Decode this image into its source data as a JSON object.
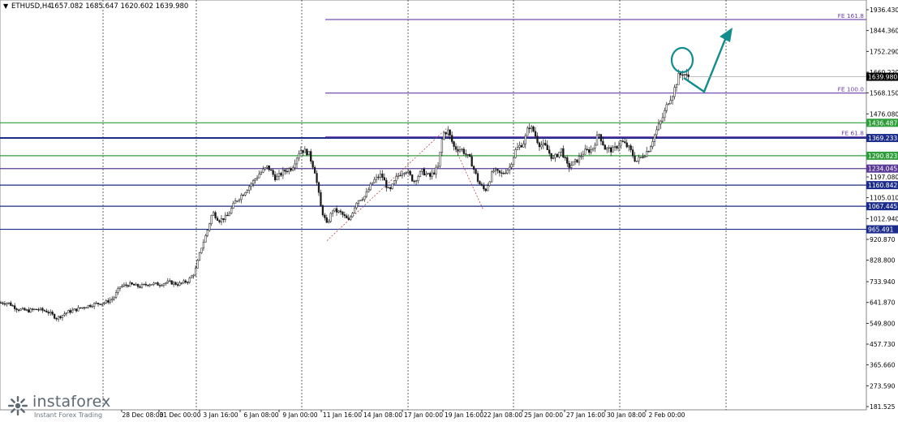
{
  "header": {
    "symbol": "ETHUSD,H4",
    "ohlc": "1657.082 1685.647 1620.602 1639.980"
  },
  "colors": {
    "fib_line": "#6a3aa8",
    "support_green": "#2f9e3a",
    "level_blue": "#1c2c8a",
    "level_purple": "#5a3a96",
    "arrow": "#138c8e",
    "candle": "#1a1a1a",
    "grid": "#000000",
    "current_price_bg": "#000000"
  },
  "chart_data": {
    "type": "candlestick",
    "symbol": "ETHUSD",
    "timeframe": "H4",
    "ylim": [
      181.525,
      1981
    ],
    "y_ticks": [
      1936.43,
      1844.36,
      1752.29,
      1660.22,
      1568.15,
      1476.08,
      1197.08,
      1105.01,
      1012.94,
      920.87,
      828.8,
      733.94,
      641.87,
      549.8,
      457.73,
      365.66,
      273.59,
      181.525
    ],
    "x_tick_labels": [
      "28 Dec 08:00",
      "31 Dec 00:00",
      "3 Jan 16:00",
      "6 Jan 08:00",
      "9 Jan 00:00",
      "11 Jan 16:00",
      "14 Jan 08:00",
      "17 Jan 00:00",
      "19 Jan 16:00",
      "22 Jan 08:00",
      "25 Jan 00:00",
      "27 Jan 16:00",
      "30 Jan 08:00",
      "2 Feb 00:00"
    ],
    "price_path": [
      [
        0,
        641
      ],
      [
        10,
        640
      ],
      [
        22,
        612
      ],
      [
        34,
        605
      ],
      [
        46,
        612
      ],
      [
        58,
        603
      ],
      [
        70,
        572
      ],
      [
        82,
        598
      ],
      [
        94,
        611
      ],
      [
        106,
        625
      ],
      [
        118,
        636
      ],
      [
        130,
        642
      ],
      [
        140,
        662
      ],
      [
        148,
        712
      ],
      [
        160,
        722
      ],
      [
        172,
        712
      ],
      [
        184,
        725
      ],
      [
        196,
        722
      ],
      [
        208,
        732
      ],
      [
        220,
        722
      ],
      [
        232,
        738
      ],
      [
        240,
        775
      ],
      [
        248,
        882
      ],
      [
        255,
        952
      ],
      [
        262,
        1042
      ],
      [
        270,
        1005
      ],
      [
        280,
        1022
      ],
      [
        290,
        1087
      ],
      [
        300,
        1126
      ],
      [
        310,
        1168
      ],
      [
        320,
        1212
      ],
      [
        330,
        1243
      ],
      [
        340,
        1190
      ],
      [
        350,
        1222
      ],
      [
        360,
        1238
      ],
      [
        370,
        1318
      ],
      [
        380,
        1305
      ],
      [
        388,
        1225
      ],
      [
        396,
        1055
      ],
      [
        403,
        985
      ],
      [
        410,
        1052
      ],
      [
        420,
        1038
      ],
      [
        430,
        1002
      ],
      [
        440,
        1092
      ],
      [
        450,
        1112
      ],
      [
        460,
        1178
      ],
      [
        470,
        1208
      ],
      [
        480,
        1130
      ],
      [
        490,
        1202
      ],
      [
        500,
        1230
      ],
      [
        510,
        1178
      ],
      [
        520,
        1222
      ],
      [
        530,
        1198
      ],
      [
        540,
        1240
      ],
      [
        546,
        1388
      ],
      [
        552,
        1402
      ],
      [
        560,
        1326
      ],
      [
        570,
        1316
      ],
      [
        580,
        1272
      ],
      [
        590,
        1172
      ],
      [
        598,
        1135
      ],
      [
        608,
        1225
      ],
      [
        618,
        1208
      ],
      [
        628,
        1238
      ],
      [
        636,
        1318
      ],
      [
        646,
        1352
      ],
      [
        652,
        1424
      ],
      [
        658,
        1398
      ],
      [
        664,
        1344
      ],
      [
        672,
        1332
      ],
      [
        682,
        1275
      ],
      [
        692,
        1318
      ],
      [
        700,
        1240
      ],
      [
        710,
        1265
      ],
      [
        720,
        1308
      ],
      [
        730,
        1318
      ],
      [
        738,
        1390
      ],
      [
        746,
        1322
      ],
      [
        756,
        1315
      ],
      [
        766,
        1355
      ],
      [
        776,
        1322
      ],
      [
        784,
        1265
      ],
      [
        792,
        1290
      ],
      [
        800,
        1320
      ],
      [
        808,
        1392
      ],
      [
        816,
        1452
      ],
      [
        824,
        1532
      ],
      [
        830,
        1570
      ],
      [
        836,
        1640
      ],
      [
        842,
        1660
      ],
      [
        846,
        1640
      ],
      [
        849,
        1639.98
      ]
    ],
    "current_price": 1639.98,
    "levels": [
      {
        "label": "1436.487",
        "price": 1436.487,
        "color": "support_green",
        "x_start": 0
      },
      {
        "label": "1369.233",
        "price": 1369.233,
        "color": "level_blue",
        "x_start": 0,
        "bold": true
      },
      {
        "label": "1290.823",
        "price": 1290.823,
        "color": "support_green",
        "x_start": 0
      },
      {
        "label": "1234.045",
        "price": 1234.045,
        "color": "level_purple",
        "x_start": 0
      },
      {
        "label": "1160.842",
        "price": 1160.842,
        "color": "level_blue",
        "x_start": 0
      },
      {
        "label": "1067.445",
        "price": 1067.445,
        "color": "level_blue",
        "x_start": 0
      },
      {
        "label": "965.491",
        "price": 965.491,
        "color": "level_blue",
        "x_start": 0
      }
    ],
    "fib_levels": [
      {
        "label": "FE 161.8",
        "price": 1893
      },
      {
        "label": "FE 100.0",
        "price": 1568
      },
      {
        "label": "FE 61.8",
        "price": 1374
      }
    ],
    "annotations": {
      "circle_around_peak": true,
      "arrow_path": "down-then-up",
      "fib_dotted_swing": [
        [
          403,
          915
        ],
        [
          550,
          1410
        ],
        [
          596,
          1050
        ]
      ]
    }
  }
}
